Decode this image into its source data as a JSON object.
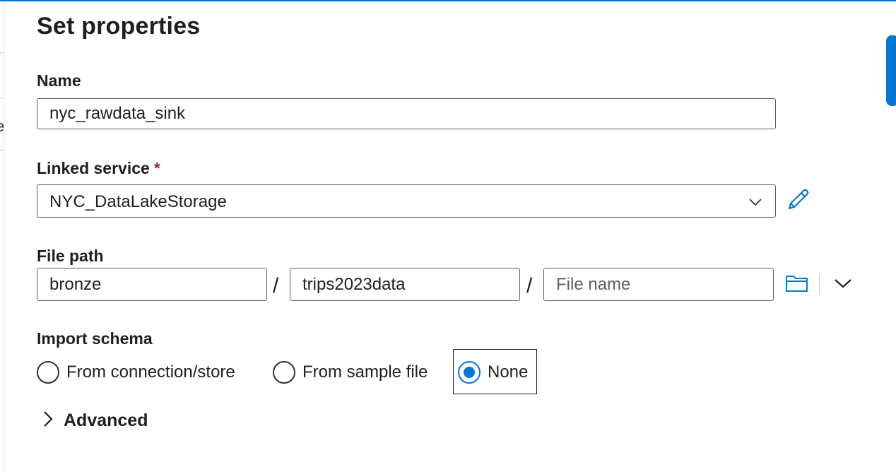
{
  "panel": {
    "title": "Set properties"
  },
  "name_field": {
    "label": "Name",
    "value": "nyc_rawdata_sink"
  },
  "linked_service": {
    "label": "Linked service",
    "required_mark": "*",
    "value": "NYC_DataLakeStorage"
  },
  "file_path": {
    "label": "File path",
    "container": "bronze",
    "directory": "trips2023data",
    "file_placeholder": "File name",
    "separator": "/"
  },
  "import_schema": {
    "label": "Import schema",
    "options": [
      {
        "label": "From connection/store",
        "selected": false
      },
      {
        "label": "From sample file",
        "selected": false
      },
      {
        "label": "None",
        "selected": true
      }
    ]
  },
  "advanced": {
    "label": "Advanced"
  },
  "left_edge": {
    "clipped_text": "e"
  },
  "icons": {
    "edit": "pencil-icon",
    "browse": "folder-icon",
    "more": "chevron-down-icon",
    "expand": "chevron-right-icon"
  },
  "colors": {
    "accent": "#0078d4",
    "required": "#a4262c",
    "text": "#201f1e",
    "border": "#605e5c"
  }
}
